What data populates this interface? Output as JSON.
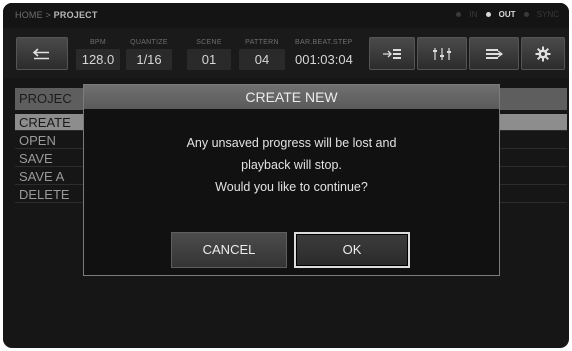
{
  "breadcrumb": {
    "home": "HOME >",
    "current": "PROJECT"
  },
  "status": {
    "in_label": "IN",
    "out_label": "OUT",
    "sync_label": "SYNC"
  },
  "toolbar": {
    "bpm": {
      "label": "BPM",
      "value": "128.0"
    },
    "quantize": {
      "label": "QUANTIZE",
      "value": "1/16"
    },
    "scene": {
      "label": "SCENE",
      "value": "01"
    },
    "pattern": {
      "label": "PATTERN",
      "value": "04"
    },
    "position": {
      "label": "BAR.BEAT.STEP",
      "value": "001:03:04"
    }
  },
  "menu": {
    "header": "PROJEC",
    "items": [
      "CREATE",
      "OPEN",
      "SAVE",
      "SAVE A",
      "DELETE"
    ]
  },
  "dialog": {
    "title": "CREATE NEW",
    "message": [
      "Any unsaved progress will be lost and",
      "playback will stop.",
      "Would you like to continue?"
    ],
    "cancel_label": "CANCEL",
    "ok_label": "OK"
  },
  "colors": {
    "screen_bg": "#161616",
    "dialog_title_bg": "#5a5a5a",
    "selected_row": "#8d8d8d"
  }
}
